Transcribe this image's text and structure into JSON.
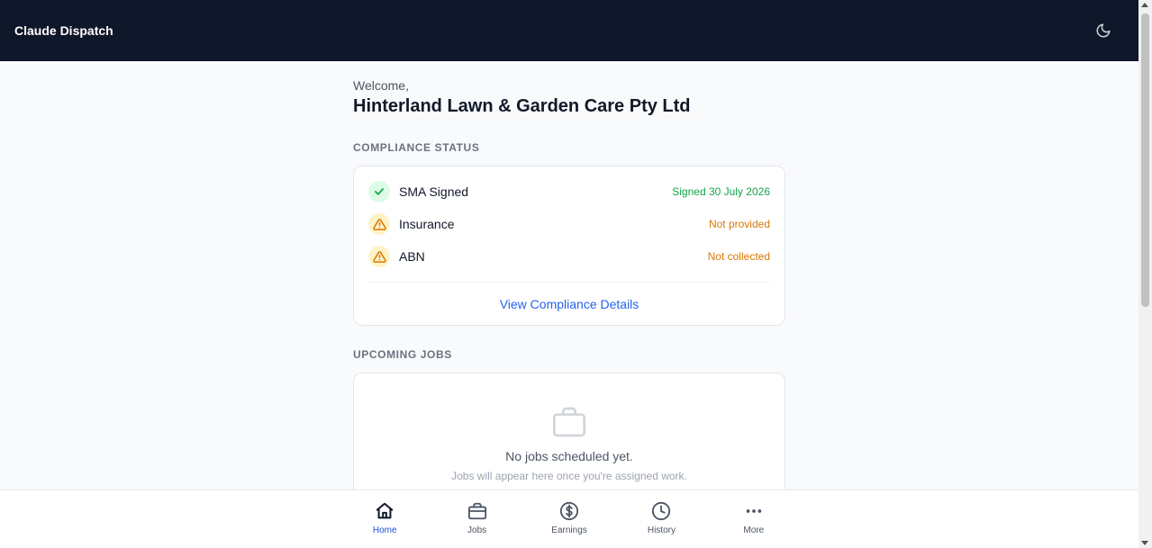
{
  "app": {
    "title": "Claude Dispatch"
  },
  "header": {
    "theme_icon": "moon-icon"
  },
  "welcome": {
    "greeting": "Welcome,",
    "company": "Hinterland Lawn & Garden Care Pty Ltd"
  },
  "compliance": {
    "section_title": "COMPLIANCE STATUS",
    "items": [
      {
        "label": "SMA Signed",
        "value": "Signed 30 July 2026",
        "status": "ok",
        "icon": "check-icon",
        "color": "#16a34a"
      },
      {
        "label": "Insurance",
        "value": "Not provided",
        "status": "warning",
        "icon": "warning-icon",
        "color": "#d97706"
      },
      {
        "label": "ABN",
        "value": "Not collected",
        "status": "warning",
        "icon": "warning-icon",
        "color": "#d97706"
      }
    ],
    "link_label": "View Compliance Details"
  },
  "jobs": {
    "section_title": "UPCOMING JOBS",
    "empty_icon": "briefcase-icon",
    "empty_title": "No jobs scheduled yet.",
    "empty_subtitle": "Jobs will appear here once you're assigned work."
  },
  "nav": {
    "items": [
      {
        "label": "Home",
        "icon": "home-icon",
        "active": true
      },
      {
        "label": "Jobs",
        "icon": "briefcase-icon"
      },
      {
        "label": "Earnings",
        "icon": "dollar-icon"
      },
      {
        "label": "History",
        "icon": "clock-icon"
      },
      {
        "label": "More",
        "icon": "more-icon"
      }
    ]
  },
  "colors": {
    "header_bg": "#0f172a",
    "accent": "#2563eb",
    "success": "#16a34a",
    "warning": "#d97706"
  }
}
